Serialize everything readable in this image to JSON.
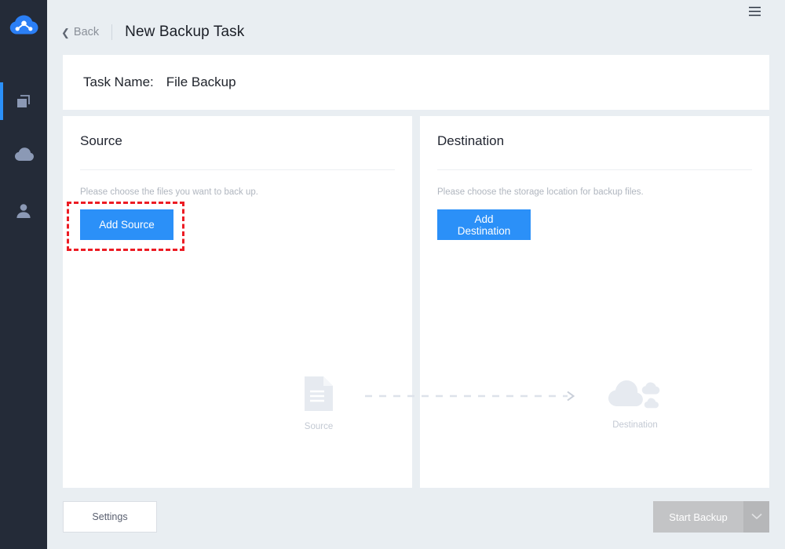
{
  "app": {
    "logo_icon": "cloud-network-logo",
    "background": "#e9eef2",
    "accent": "#2b90f8",
    "sidebar_bg": "#242b38",
    "annotation_color": "#ec1c24"
  },
  "sidebar": {
    "items": [
      {
        "name": "backup",
        "icon": "copy-layers-icon",
        "active": true
      },
      {
        "name": "cloud",
        "icon": "cloud-icon",
        "active": false
      },
      {
        "name": "account",
        "icon": "person-icon",
        "active": false
      }
    ]
  },
  "titlebar": {
    "menu_icon": "hamburger-menu-icon",
    "minimize_icon": "minimize-icon",
    "close_icon": "close-icon"
  },
  "header": {
    "back_label": "Back",
    "back_icon": "chevron-left-icon",
    "title": "New Backup Task"
  },
  "task": {
    "label": "Task Name:",
    "value": "File Backup"
  },
  "source": {
    "title": "Source",
    "hint": "Please choose the files you want to back up.",
    "button_label": "Add Source",
    "highlighted": true
  },
  "destination": {
    "title": "Destination",
    "hint": "Please choose the storage location for backup files.",
    "button_label": "Add Destination"
  },
  "placeholder": {
    "source_icon": "document-icon",
    "source_label": "Source",
    "arrow_icon": "dashed-arrow-right-icon",
    "destination_icon": "cloud-icon",
    "destination_label": "Destination"
  },
  "footer": {
    "settings_label": "Settings",
    "start_label": "Start Backup",
    "start_caret_icon": "chevron-down-icon",
    "start_disabled": true
  }
}
